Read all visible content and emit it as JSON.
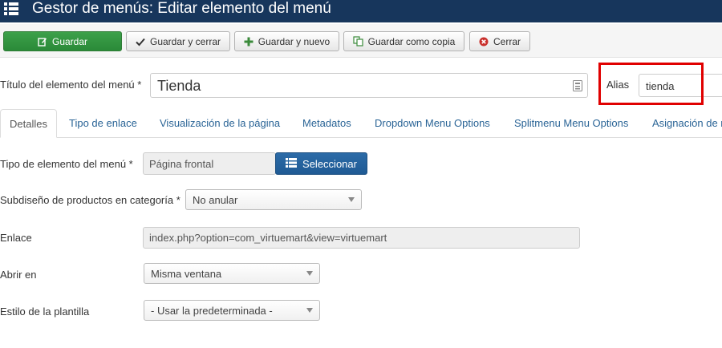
{
  "header": {
    "title": "Gestor de menús: Editar elemento del menú",
    "icon": "list-icon"
  },
  "toolbar": {
    "save_label": "Guardar",
    "save_close_label": "Guardar y cerrar",
    "save_new_label": "Guardar y nuevo",
    "save_copy_label": "Guardar como copia",
    "close_label": "Cerrar"
  },
  "form": {
    "title_label": "Título del elemento del menú *",
    "title_value": "Tienda",
    "alias_label": "Alias",
    "alias_value": "tienda"
  },
  "tabs": [
    {
      "label": "Detalles",
      "active": true
    },
    {
      "label": "Tipo de enlace"
    },
    {
      "label": "Visualización de la página"
    },
    {
      "label": "Metadatos"
    },
    {
      "label": "Dropdown Menu Options"
    },
    {
      "label": "Splitmenu Menu Options"
    },
    {
      "label": "Asignación de m"
    }
  ],
  "details": {
    "type_label": "Tipo de elemento del menú *",
    "type_value": "Página frontal",
    "select_button_label": "Seleccionar",
    "subdesign_label": "Subdiseño de productos en categoría *",
    "subdesign_value": "No anular",
    "link_label": "Enlace",
    "link_value": "index.php?option=com_virtuemart&view=virtuemart",
    "open_label": "Abrir en",
    "open_value": "Misma ventana",
    "style_label": "Estilo de la plantilla",
    "style_value": "- Usar la predeterminada -"
  },
  "colors": {
    "header_bg": "#17365c",
    "primary_green": "#3da14a",
    "select_blue": "#2c6ba7",
    "highlight_red": "#e00000",
    "link_blue": "#2a6496"
  }
}
